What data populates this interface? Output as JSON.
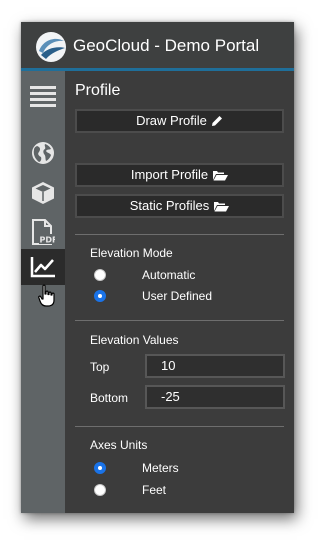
{
  "header": {
    "title": "GeoCloud - Demo Portal",
    "logo_icon": "geocloud-logo",
    "accent_color": "#1f6f9a"
  },
  "sidebar": {
    "items": [
      {
        "icon": "layers-icon",
        "active": false
      },
      {
        "icon": "globe-icon",
        "active": false
      },
      {
        "icon": "cube-icon",
        "active": false
      },
      {
        "icon": "pdf-icon",
        "label": "PDF",
        "active": false
      },
      {
        "icon": "chart-line-icon",
        "active": true
      }
    ]
  },
  "profile": {
    "title": "Profile",
    "buttons": {
      "draw": "Draw Profile",
      "import": "Import Profile",
      "static": "Static Profiles"
    },
    "elevation_mode": {
      "label": "Elevation Mode",
      "options": [
        "Automatic",
        "User Defined"
      ],
      "selected": "User Defined"
    },
    "elevation_values": {
      "label": "Elevation Values",
      "top_label": "Top",
      "top_value": "10",
      "bottom_label": "Bottom",
      "bottom_value": "-25"
    },
    "axes_units": {
      "label": "Axes Units",
      "options": [
        "Meters",
        "Feet"
      ],
      "selected": "Meters"
    }
  }
}
